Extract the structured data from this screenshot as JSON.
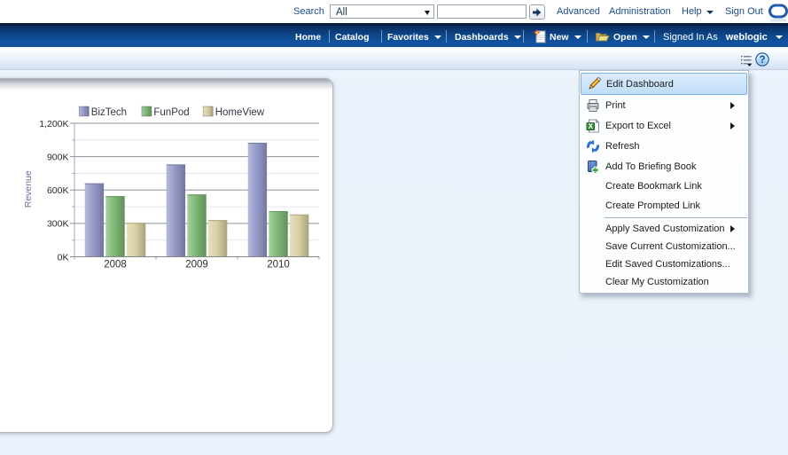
{
  "topbar": {
    "search_label": "Search",
    "search_scope_value": "All",
    "search_input_value": "",
    "links": {
      "advanced": "Advanced",
      "administration": "Administration",
      "help": "Help",
      "sign_out": "Sign Out"
    }
  },
  "navbar": {
    "items": {
      "home": "Home",
      "catalog": "Catalog",
      "favorites": "Favorites",
      "dashboards": "Dashboards",
      "new": "New",
      "open": "Open"
    },
    "signed_in_as": "Signed In As",
    "username": "weblogic"
  },
  "menu": {
    "items": [
      {
        "label": "Edit Dashboard",
        "icon": "pencil-icon",
        "highlighted": true
      },
      {
        "label": "Print",
        "icon": "printer-icon",
        "submenu": true
      },
      {
        "label": "Export to Excel",
        "icon": "excel-icon",
        "submenu": true
      },
      {
        "label": "Refresh",
        "icon": "refresh-icon"
      },
      {
        "label": "Add To Briefing Book",
        "icon": "briefing-book-icon"
      },
      {
        "label": "Create Bookmark Link"
      },
      {
        "label": "Create Prompted Link"
      },
      {
        "separator": true
      },
      {
        "label": "Apply Saved Customization",
        "submenu": true
      },
      {
        "label": "Save Current Customization..."
      },
      {
        "label": "Edit Saved Customizations..."
      },
      {
        "label": "Clear My Customization"
      }
    ]
  },
  "chart_data": {
    "type": "bar",
    "title": "",
    "categories": [
      "2008",
      "2009",
      "2010"
    ],
    "series": [
      {
        "name": "BizTech",
        "color": "#9599c9",
        "values": [
          660,
          830,
          1025
        ]
      },
      {
        "name": "FunPod",
        "color": "#7db875",
        "values": [
          545,
          560,
          410
        ]
      },
      {
        "name": "HomeView",
        "color": "#d8d1a2",
        "values": [
          305,
          330,
          380
        ]
      }
    ],
    "value_unit": "K",
    "xlabel": "",
    "ylabel": "Revenue",
    "ylim": [
      0,
      1200
    ],
    "ytick_step": 300,
    "ytick_minor_step": 150,
    "ytick_labels": [
      "0K",
      "300K",
      "600K",
      "900K",
      "1,200K"
    ],
    "legend_position": "top",
    "grid": true
  },
  "colors": {
    "navbar_blue": "#10529e",
    "topbar_link": "#1c4c87",
    "menu_highlight": "#bfddf8",
    "brand_logo_blue": "#1d5fae"
  }
}
